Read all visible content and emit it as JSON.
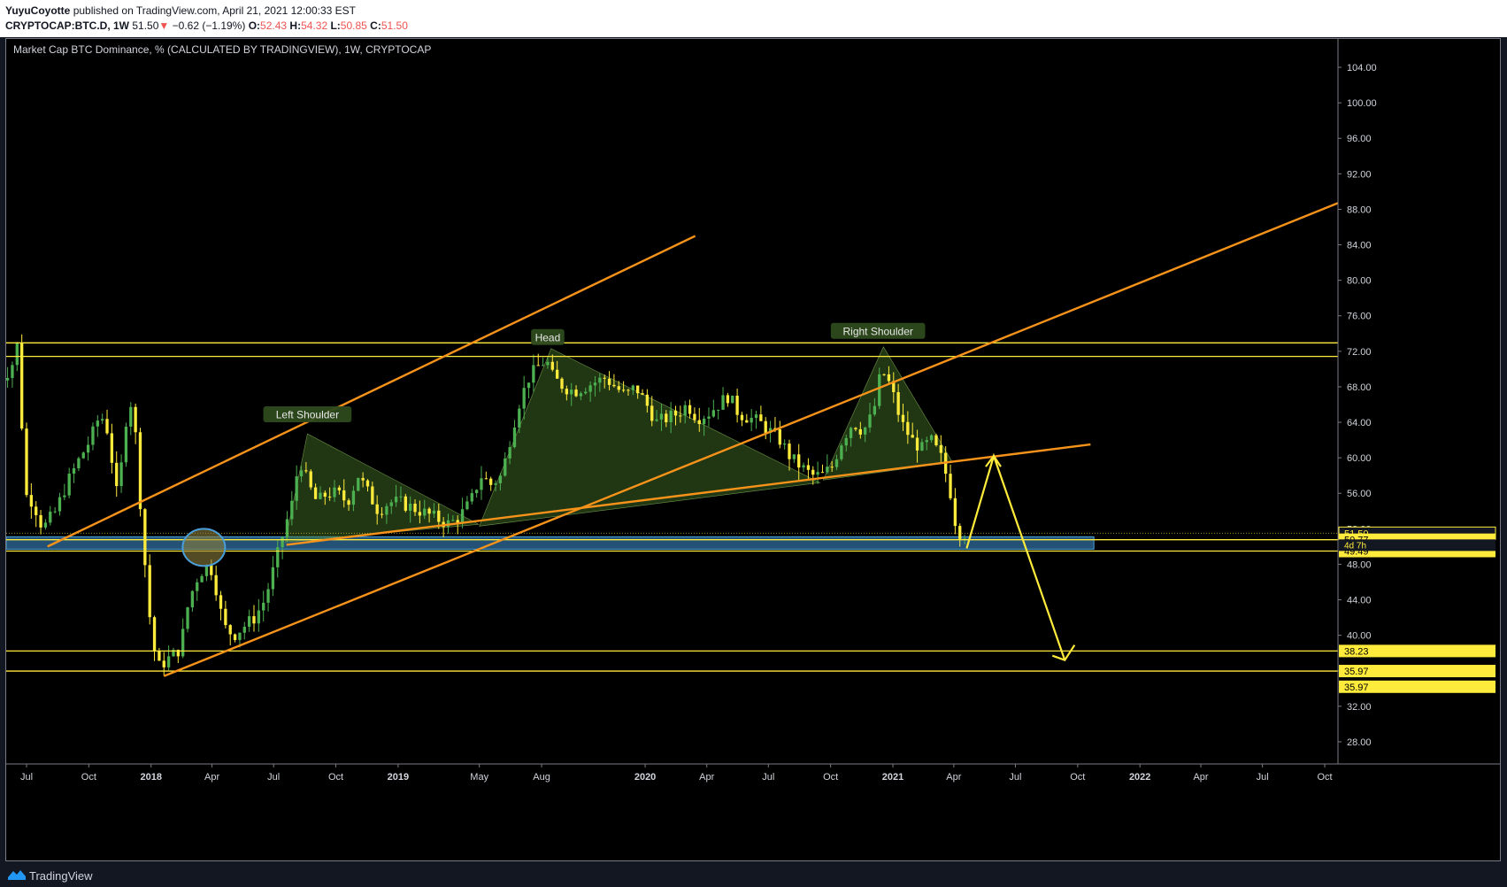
{
  "header": {
    "author": "YuyuCoyotte",
    "published_text": "published on TradingView.com, April 21, 2021 12:00:33 EST",
    "symbol": "CRYPTOCAP:BTC.D, 1W",
    "last": "51.50",
    "change_arrow": "▼",
    "change": "−0.62 (−1.19%)",
    "o_label": "O:",
    "o_value": "52.43",
    "h_label": "H:",
    "h_value": "54.32",
    "l_label": "L:",
    "l_value": "50.85",
    "c_label": "C:",
    "c_value": "51.50"
  },
  "footer": {
    "brand": "TradingView"
  },
  "colors": {
    "background": "#000000",
    "up_candle": "#4caf50",
    "down_candle": "#ffeb3b",
    "trendline": "#f7931a",
    "level_line": "#ffeb3b",
    "support_zone": "#2f6e9e",
    "pattern_fill": "#4a7a2c",
    "label_bg": "#2e4a1e"
  },
  "chart_data": {
    "type": "candlestick",
    "title": "Market Cap BTC Dominance, % (CALCULATED BY TRADINGVIEW), 1W, CRYPTOCAP",
    "ylim": [
      25.5,
      106
    ],
    "y_ticks": [
      "104.00",
      "100.00",
      "96.00",
      "92.00",
      "88.00",
      "84.00",
      "80.00",
      "76.00",
      "72.00",
      "68.00",
      "64.00",
      "60.00",
      "56.00",
      "52.00",
      "48.00",
      "44.00",
      "40.00",
      "36.00",
      "32.00",
      "28.00"
    ],
    "x_ticks": [
      {
        "label": "Jul",
        "date": "2017-07-01",
        "bold": false
      },
      {
        "label": "Oct",
        "date": "2017-10-01",
        "bold": false
      },
      {
        "label": "2018",
        "date": "2018-01-01",
        "bold": true
      },
      {
        "label": "Apr",
        "date": "2018-04-01",
        "bold": false
      },
      {
        "label": "Jul",
        "date": "2018-07-01",
        "bold": false
      },
      {
        "label": "Oct",
        "date": "2018-10-01",
        "bold": false
      },
      {
        "label": "2019",
        "date": "2019-01-01",
        "bold": true
      },
      {
        "label": "May",
        "date": "2019-05-01",
        "bold": false
      },
      {
        "label": "Aug",
        "date": "2019-08-01",
        "bold": false
      },
      {
        "label": "2020",
        "date": "2020-01-01",
        "bold": true
      },
      {
        "label": "Apr",
        "date": "2020-04-01",
        "bold": false
      },
      {
        "label": "Jul",
        "date": "2020-07-01",
        "bold": false
      },
      {
        "label": "Oct",
        "date": "2020-10-01",
        "bold": false
      },
      {
        "label": "2021",
        "date": "2021-01-01",
        "bold": true
      },
      {
        "label": "Apr",
        "date": "2021-04-01",
        "bold": false
      },
      {
        "label": "Jul",
        "date": "2021-07-01",
        "bold": false
      },
      {
        "label": "Oct",
        "date": "2021-10-01",
        "bold": false
      },
      {
        "label": "2022",
        "date": "2022-01-01",
        "bold": true
      },
      {
        "label": "Apr",
        "date": "2022-04-01",
        "bold": false
      },
      {
        "label": "Jul",
        "date": "2022-07-01",
        "bold": false
      },
      {
        "label": "Oct",
        "date": "2022-10-01",
        "bold": false
      }
    ],
    "price_path": [
      [
        "2017-05-20",
        70
      ],
      [
        "2017-06-05",
        69
      ],
      [
        "2017-06-20",
        71
      ],
      [
        "2017-06-27",
        74
      ],
      [
        "2017-07-04",
        56
      ],
      [
        "2017-07-18",
        55
      ],
      [
        "2017-08-01",
        52
      ],
      [
        "2017-08-20",
        54
      ],
      [
        "2017-09-05",
        57
      ],
      [
        "2017-09-25",
        60
      ],
      [
        "2017-10-10",
        62
      ],
      [
        "2017-10-25",
        65
      ],
      [
        "2017-11-05",
        63
      ],
      [
        "2017-11-20",
        55
      ],
      [
        "2017-12-01",
        64
      ],
      [
        "2017-12-12",
        67
      ],
      [
        "2017-12-20",
        58
      ],
      [
        "2018-01-01",
        46
      ],
      [
        "2018-01-10",
        39
      ],
      [
        "2018-01-20",
        36.5
      ],
      [
        "2018-02-05",
        37.5
      ],
      [
        "2018-02-20",
        38.5
      ],
      [
        "2018-03-05",
        44
      ],
      [
        "2018-03-20",
        47
      ],
      [
        "2018-04-05",
        48
      ],
      [
        "2018-04-15",
        45
      ],
      [
        "2018-04-25",
        41
      ],
      [
        "2018-05-10",
        40
      ],
      [
        "2018-05-25",
        41
      ],
      [
        "2018-06-10",
        42
      ],
      [
        "2018-06-25",
        44
      ],
      [
        "2018-07-10",
        48
      ],
      [
        "2018-07-24",
        52
      ],
      [
        "2018-08-05",
        55
      ],
      [
        "2018-08-15",
        60
      ],
      [
        "2018-08-28",
        57
      ],
      [
        "2018-09-10",
        55
      ],
      [
        "2018-09-25",
        56
      ],
      [
        "2018-10-10",
        56
      ],
      [
        "2018-10-25",
        55
      ],
      [
        "2018-11-10",
        58
      ],
      [
        "2018-11-25",
        56
      ],
      [
        "2018-12-10",
        54
      ],
      [
        "2018-12-25",
        55
      ],
      [
        "2019-01-10",
        55
      ],
      [
        "2019-01-25",
        54.5
      ],
      [
        "2019-02-10",
        54
      ],
      [
        "2019-02-25",
        53.5
      ],
      [
        "2019-03-10",
        53
      ],
      [
        "2019-03-25",
        52.5
      ],
      [
        "2019-04-10",
        53.5
      ],
      [
        "2019-04-25",
        55
      ],
      [
        "2019-05-10",
        58
      ],
      [
        "2019-05-25",
        57
      ],
      [
        "2019-06-10",
        58
      ],
      [
        "2019-06-25",
        63
      ],
      [
        "2019-07-05",
        66
      ],
      [
        "2019-07-20",
        69
      ],
      [
        "2019-08-05",
        70.5
      ],
      [
        "2019-08-15",
        71
      ],
      [
        "2019-08-25",
        69
      ],
      [
        "2019-09-10",
        68
      ],
      [
        "2019-09-25",
        67.5
      ],
      [
        "2019-10-10",
        68
      ],
      [
        "2019-10-25",
        68.5
      ],
      [
        "2019-11-10",
        69
      ],
      [
        "2019-11-25",
        68
      ],
      [
        "2019-12-10",
        67
      ],
      [
        "2019-12-25",
        68
      ],
      [
        "2020-01-10",
        66
      ],
      [
        "2020-01-25",
        64
      ],
      [
        "2020-02-10",
        64.5
      ],
      [
        "2020-02-25",
        65
      ],
      [
        "2020-03-10",
        66
      ],
      [
        "2020-03-25",
        64.5
      ],
      [
        "2020-04-10",
        65
      ],
      [
        "2020-04-25",
        66
      ],
      [
        "2020-05-10",
        67
      ],
      [
        "2020-05-25",
        65
      ],
      [
        "2020-06-10",
        64.5
      ],
      [
        "2020-06-25",
        64
      ],
      [
        "2020-07-10",
        63
      ],
      [
        "2020-07-25",
        62
      ],
      [
        "2020-08-10",
        60
      ],
      [
        "2020-08-25",
        59
      ],
      [
        "2020-09-10",
        58
      ],
      [
        "2020-09-25",
        58
      ],
      [
        "2020-10-10",
        59
      ],
      [
        "2020-10-25",
        62
      ],
      [
        "2020-11-10",
        64
      ],
      [
        "2020-11-25",
        63
      ],
      [
        "2020-12-10",
        65
      ],
      [
        "2020-12-22",
        70
      ],
      [
        "2021-01-05",
        68
      ],
      [
        "2021-01-20",
        64
      ],
      [
        "2021-02-05",
        62
      ],
      [
        "2021-02-20",
        61
      ],
      [
        "2021-03-05",
        62
      ],
      [
        "2021-03-20",
        60
      ],
      [
        "2021-04-01",
        57
      ],
      [
        "2021-04-12",
        52
      ],
      [
        "2021-04-19",
        51.5
      ]
    ],
    "horizontal_levels": [
      {
        "value": 72.95,
        "label": "72.95"
      },
      {
        "value": 71.42,
        "label": "71.42"
      },
      {
        "value": 50.77,
        "label": "50.77"
      },
      {
        "value": 49.49,
        "label": "49.49"
      },
      {
        "value": 38.23,
        "label": "38.23"
      },
      {
        "value": 35.97,
        "label": "35.97"
      }
    ],
    "price_tags": [
      {
        "value": 51.5,
        "label": "51.50",
        "style": "current"
      },
      {
        "value": 50.77,
        "label": "50.77",
        "style": "level"
      },
      {
        "value": 49.49,
        "label": "49.49",
        "style": "level"
      },
      {
        "value": 38.23,
        "label": "38.23",
        "style": "level"
      },
      {
        "value": 35.97,
        "label": "35.97",
        "style": "level"
      },
      {
        "value": 34.2,
        "label": "35.97",
        "style": "level"
      }
    ],
    "countdown": "4d 7h",
    "support_zone": {
      "from": "2017-06-01",
      "to": "2021-10-25",
      "low": 49.7,
      "high": 51.1
    },
    "support_ellipse": {
      "center": "2018-03-20",
      "value": 49.9
    },
    "trendlines": [
      {
        "from": [
          "2017-08-01",
          50
        ],
        "to": [
          "2020-03-15",
          85
        ]
      },
      {
        "from": [
          "2018-01-20",
          35.4
        ],
        "to": [
          "2023-06-15",
          96
        ]
      },
      {
        "from": [
          "2018-07-20",
          50.2
        ],
        "to": [
          "2021-10-20",
          61.5
        ]
      }
    ],
    "pattern_triangles": [
      [
        [
          "2018-07-18",
          50.5
        ],
        [
          "2018-08-20",
          62.7
        ],
        [
          "2019-04-30",
          52.5
        ]
      ],
      [
        [
          "2019-05-01",
          52.3
        ],
        [
          "2019-08-15",
          72.3
        ],
        [
          "2020-09-15",
          57.2
        ]
      ],
      [
        [
          "2020-09-20",
          57.5
        ],
        [
          "2020-12-18",
          72.5
        ],
        [
          "2021-03-30",
          59.5
        ]
      ]
    ],
    "pattern_labels": [
      {
        "text": "Left Shoulder",
        "at": [
          "2018-08-20",
          64.8
        ]
      },
      {
        "text": "Head",
        "at": [
          "2019-08-10",
          73.5
        ]
      },
      {
        "text": "Right Shoulder",
        "at": [
          "2020-12-10",
          74.2
        ]
      }
    ],
    "projection_arrow": [
      [
        "2021-04-20",
        49.8
      ],
      [
        "2021-05-30",
        60.2
      ],
      [
        "2021-09-12",
        37.2
      ]
    ],
    "grid": false,
    "legend": "none"
  }
}
